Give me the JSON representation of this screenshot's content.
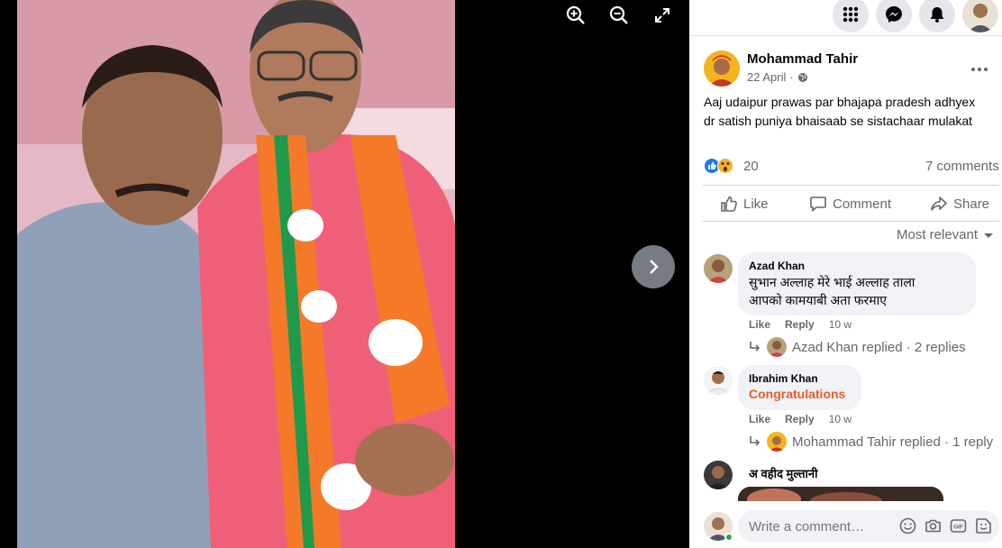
{
  "viewer": {
    "zoom_in_icon": "zoom-in-icon",
    "zoom_out_icon": "zoom-out-icon",
    "fullscreen_icon": "fullscreen-icon",
    "next_icon": "chevron-right-icon"
  },
  "topbar": {
    "icons": [
      "menu-grid-icon",
      "messenger-icon",
      "bell-icon",
      "profile-avatar"
    ]
  },
  "post": {
    "author": "Mohammad Tahir",
    "date": "22 April",
    "privacy_icon": "globe-icon",
    "text_line1": "Aaj udaipur prawas par bhajapa pradesh adhyex",
    "text_line2": "dr satish puniya bhaisaab se sistachaar mulakat",
    "reaction_count": "20",
    "comments_count": "7 comments",
    "like_label": "Like",
    "comment_label": "Comment",
    "share_label": "Share",
    "sort_label": "Most relevant"
  },
  "comments": [
    {
      "author": "Azad Khan",
      "text_line1": "सुभान अल्लाह मेरे भाई अल्लाह ताला",
      "text_line2": "आपको कामयाबी अता फरमाए",
      "like": "Like",
      "reply": "Reply",
      "time": "10 w",
      "replies": "Azad Khan replied · 2 replies"
    },
    {
      "author": "Ibrahim Khan",
      "text_line1": "Congratulations",
      "like": "Like",
      "reply": "Reply",
      "time": "10 w",
      "replies": "Mohammad Tahir replied · 1 reply"
    },
    {
      "author": "अ वहीद मुल्तानी"
    }
  ],
  "composer": {
    "placeholder": "Write a comment…",
    "icons": [
      "emoji-icon",
      "camera-icon",
      "gif-icon",
      "sticker-icon"
    ]
  },
  "colors": {
    "accent": "#1877f2",
    "congrats": "#f05a28",
    "muted": "#65676b"
  }
}
